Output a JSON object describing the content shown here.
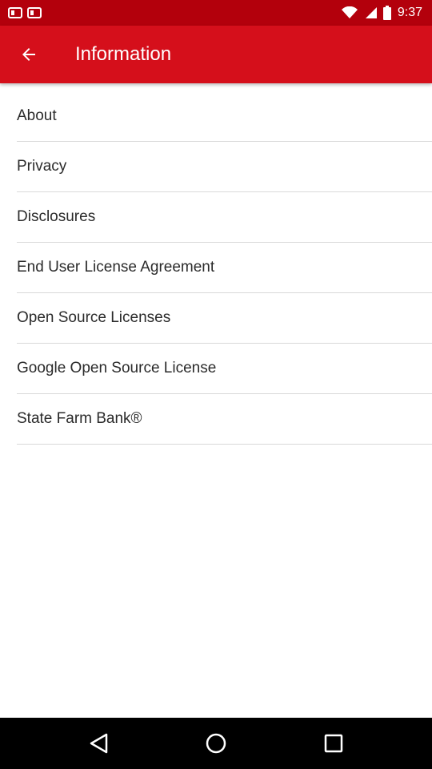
{
  "status_bar": {
    "time": "9:37"
  },
  "app_bar": {
    "title": "Information"
  },
  "items": [
    {
      "id": "about",
      "label": "About"
    },
    {
      "id": "privacy",
      "label": "Privacy"
    },
    {
      "id": "disclosures",
      "label": "Disclosures"
    },
    {
      "id": "eula",
      "label": "End User License Agreement"
    },
    {
      "id": "open-source-licenses",
      "label": "Open Source Licenses"
    },
    {
      "id": "google-open-source-license",
      "label": "Google Open Source License"
    },
    {
      "id": "state-farm-bank",
      "label": "State Farm Bank®"
    }
  ],
  "colors": {
    "status_bar": "#b3000c",
    "app_bar": "#d50f1b",
    "text": "#2b2b2b",
    "divider": "#d9d9d9"
  },
  "icons": {
    "back": "arrow-left-icon",
    "nav_back": "triangle-back-icon",
    "nav_home": "circle-home-icon",
    "nav_recents": "square-recents-icon"
  }
}
